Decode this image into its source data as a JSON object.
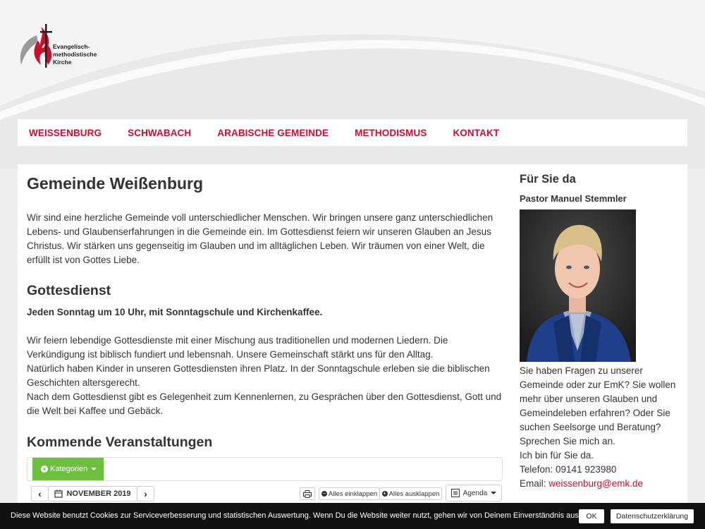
{
  "logo": {
    "line1": "Evangelisch-",
    "line2": "methodistische",
    "line3": "Kirche"
  },
  "nav": {
    "items": [
      "WEISSENBURG",
      "SCHWABACH",
      "ARABISCHE GEMEINDE",
      "METHODISMUS",
      "KONTAKT"
    ]
  },
  "main": {
    "title": "Gemeinde Weißenburg",
    "intro": "Wir sind eine herzliche Gemeinde voll unterschiedlicher Menschen. Wir bringen unsere ganz unterschiedlichen Lebens- und Glaubenserfahrungen in die Gemeinde ein. Im Gottesdienst feiern wir unseren Glauben an Jesus Christus. Wir stärken uns gegenseitig im Glauben und im alltäglichen Leben. Wir träumen von einer Welt, die erfüllt ist von Gottes Liebe.",
    "gottesdienst_title": "Gottesdienst",
    "gottesdienst_bold": "Jeden Sonntag um 10 Uhr, mit Sonntagschule und Kirchenkaffee.",
    "gottesdienst_p1": "Wir feiern lebendige Gottesdienste mit einer Mischung aus traditionellen und modernen Liedern. Die Verkündigung ist biblisch fundiert und lebensnah. Unsere Gemeinschaft stärkt uns für den Alltag.",
    "gottesdienst_p2": "Natürlich haben Kinder in unseren Gottesdiensten ihren Platz. In der Sonntagschule erleben sie die biblischen Geschichten altersgerecht.",
    "gottesdienst_p3": "Nach dem Gottesdienst gibt es Gelegenheit zum Kennenlernen, zu Gesprächen über den Gottesdienst, Gott und die Welt bei Kaffee und Gebäck.",
    "events_title": "Kommende Veranstaltungen"
  },
  "calendar": {
    "kategorien": "Kategorien",
    "month": "NOVEMBER 2019",
    "prev": "‹",
    "next": "›",
    "collapse_all": "Alles einklappen",
    "expand_all": "Alles ausklappen",
    "view": "Agenda"
  },
  "sidebar": {
    "title": "Für Sie da",
    "name": "Pastor Manuel Stemmler",
    "text": "Sie haben Fragen zu unserer Gemeinde oder zur EmK? Sie wollen mehr über unseren Glauben und Gemeindeleben erfahren? Oder Sie suchen Seelsorge und Beratung? Sprechen Sie mich an.",
    "line2": "Ich bin für Sie da.",
    "phone": "Telefon: 09141 923980",
    "email_label": "Email: ",
    "email": "weissenburg@emk.de"
  },
  "cookie": {
    "text": "Diese Website benutzt Cookies zur Serviceverbesserung und statistischen Auswertung. Wenn Du die Website weiter nutzt, gehen wir von Deinem Einverständnis aus.",
    "ok": "OK",
    "privacy": "Datenschutzerklärung"
  },
  "colors": {
    "accent": "#c8102e",
    "green": "#6cbf3f",
    "cookie_bg": "#111111"
  }
}
